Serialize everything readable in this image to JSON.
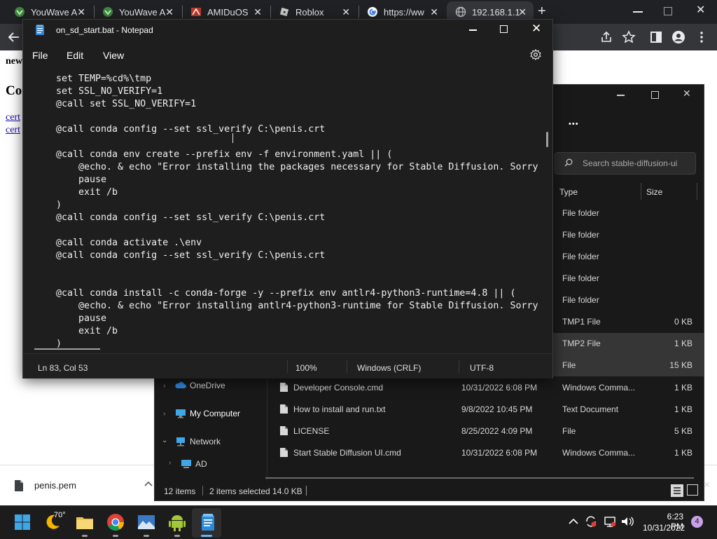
{
  "browser": {
    "tabs": [
      {
        "title": "YouWave A",
        "icon": "youwave-icon"
      },
      {
        "title": "YouWave A",
        "icon": "youwave-icon"
      },
      {
        "title": "AMIDuOS",
        "icon": "amiduos-icon"
      },
      {
        "title": "Roblox",
        "icon": "roblox-icon"
      },
      {
        "title": "https://ww",
        "icon": "google-icon"
      },
      {
        "title": "192.168.1.1",
        "icon": "globe-icon"
      }
    ],
    "new_tab_symbol": "+",
    "page_fragments": {
      "line1": "new",
      "heading": "Co",
      "link1": "cert",
      "link2": "cert"
    },
    "download": {
      "filename": "penis.pem"
    }
  },
  "explorer": {
    "search_placeholder": "Search stable-diffusion-ui",
    "more_symbol": "•••",
    "columns": {
      "type": "Type",
      "size": "Size"
    },
    "upper_rows": [
      {
        "type": "File folder",
        "size": "",
        "selected": false
      },
      {
        "type": "File folder",
        "size": "",
        "selected": false
      },
      {
        "type": "File folder",
        "size": "",
        "selected": false
      },
      {
        "type": "File folder",
        "size": "",
        "selected": false
      },
      {
        "type": "File folder",
        "size": "",
        "selected": false
      },
      {
        "type": "TMP1 File",
        "size": "0 KB",
        "selected": false
      },
      {
        "type": "TMP2 File",
        "size": "1 KB",
        "selected": true
      },
      {
        "type": "File",
        "size": "15 KB",
        "selected": true
      }
    ],
    "files": [
      {
        "name": "Developer Console.cmd",
        "date": "10/31/2022 6:08 PM",
        "type": "Windows Comma...",
        "size": "1 KB"
      },
      {
        "name": "How to install and run.txt",
        "date": "9/8/2022 10:45 PM",
        "type": "Text Document",
        "size": "1 KB"
      },
      {
        "name": "LICENSE",
        "date": "8/25/2022 4:09 PM",
        "type": "File",
        "size": "5 KB"
      },
      {
        "name": "Start Stable Diffusion UI.cmd",
        "date": "10/31/2022 6:08 PM",
        "type": "Windows Comma...",
        "size": "1 KB"
      }
    ],
    "nav": {
      "onedrive": "OneDrive",
      "mycomputer": "My Computer",
      "network": "Network",
      "ad": "AD"
    },
    "status": {
      "items": "12 items",
      "selected": "2 items selected  14.0 KB"
    }
  },
  "notepad": {
    "title": "on_sd_start.bat - Notepad",
    "menu": {
      "file": "File",
      "edit": "Edit",
      "view": "View"
    },
    "code": "set TEMP=%cd%\\tmp\nset SSL_NO_VERIFY=1\n@call set SSL_NO_VERIFY=1\n\n@call conda config --set ssl_verify C:\\penis.crt\n\n@call conda env create --prefix env -f environment.yaml || (\n    @echo. & echo \"Error installing the packages necessary for Stable Diffusion. Sorry\n    pause\n    exit /b\n)\n@call conda config --set ssl_verify C:\\penis.crt\n\n@call conda activate .\\env\n@call conda config --set ssl_verify C:\\penis.crt\n\n\n@call conda install -c conda-forge -y --prefix env antlr4-python3-runtime=4.8 || (\n    @echo. & echo \"Error installing antlr4-python3-runtime for Stable Diffusion. Sorry\n    pause\n    exit /b\n)",
    "status": {
      "position": "Ln 83, Col 53",
      "zoom": "100%",
      "eol": "Windows (CRLF)",
      "encoding": "UTF-8"
    }
  },
  "taskbar": {
    "weather": "70°",
    "time": "6:23 PM",
    "date": "10/31/2022",
    "notification_count": "4"
  }
}
